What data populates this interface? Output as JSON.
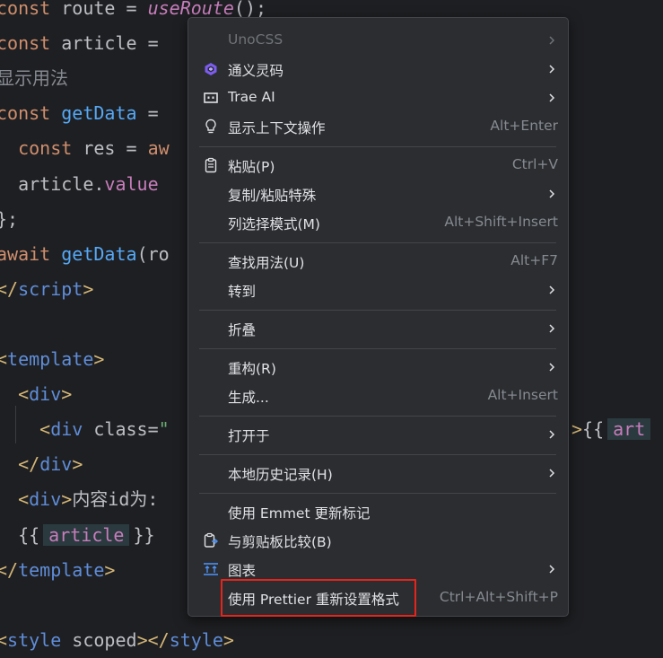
{
  "editor": {
    "lines": [
      {
        "parts": [
          [
            "kw",
            "const"
          ],
          [
            "txt",
            " route = "
          ],
          [
            "it",
            "useRoute"
          ],
          [
            "txt",
            "();"
          ]
        ]
      },
      {
        "parts": [
          [
            "kw",
            "const"
          ],
          [
            "txt",
            " article = "
          ]
        ]
      },
      {
        "parts": [
          [
            "cmt",
            "显示用法"
          ]
        ]
      },
      {
        "parts": [
          [
            "kw",
            "const"
          ],
          [
            "txt",
            " "
          ],
          [
            "fn",
            "getData"
          ],
          [
            "txt",
            " ="
          ]
        ]
      },
      {
        "parts": [
          [
            "txt",
            "  "
          ],
          [
            "kw",
            "const"
          ],
          [
            "txt",
            " res = "
          ],
          [
            "kw",
            "aw"
          ]
        ]
      },
      {
        "parts": [
          [
            "txt",
            "  article."
          ],
          [
            "prop",
            "value"
          ]
        ]
      },
      {
        "parts": [
          [
            "txt",
            "};"
          ]
        ]
      },
      {
        "parts": [
          [
            "kw",
            "await"
          ],
          [
            "txt",
            " "
          ],
          [
            "fn",
            "getData"
          ],
          [
            "txt",
            "(ro"
          ]
        ]
      },
      {
        "parts": [
          [
            "tag",
            "</"
          ],
          [
            "tg",
            "script"
          ],
          [
            "tag",
            ">"
          ]
        ]
      },
      {
        "parts": []
      },
      {
        "parts": [
          [
            "tag",
            "<"
          ],
          [
            "tg",
            "template"
          ],
          [
            "tag",
            ">"
          ]
        ]
      },
      {
        "parts": [
          [
            "txt",
            "  "
          ],
          [
            "tag",
            "<"
          ],
          [
            "tg",
            "div"
          ],
          [
            "tag",
            ">"
          ]
        ]
      },
      {
        "parts": [
          [
            "txt",
            "    "
          ],
          [
            "tag",
            "<"
          ],
          [
            "tg",
            "div"
          ],
          [
            "txt",
            " class="
          ],
          [
            "str",
            "\""
          ]
        ]
      },
      {
        "parts": [
          [
            "txt",
            "  "
          ],
          [
            "tag",
            "</"
          ],
          [
            "tg",
            "div"
          ],
          [
            "tag",
            ">"
          ]
        ]
      },
      {
        "parts": [
          [
            "txt",
            "  "
          ],
          [
            "tag",
            "<"
          ],
          [
            "tg",
            "div"
          ],
          [
            "tag",
            ">"
          ],
          [
            "txt",
            "内容id为:"
          ]
        ]
      },
      {
        "parts": [
          [
            "txt",
            "  {{"
          ],
          [
            "hl",
            "article"
          ],
          [
            "txt",
            "}}"
          ]
        ]
      },
      {
        "parts": [
          [
            "tag",
            "</"
          ],
          [
            "tg",
            "template"
          ],
          [
            "tag",
            ">"
          ]
        ]
      },
      {
        "parts": []
      },
      {
        "parts": [
          [
            "tag",
            "<"
          ],
          [
            "tg",
            "style"
          ],
          [
            "txt",
            " scoped"
          ],
          [
            "tag",
            "></"
          ],
          [
            "tg",
            "style"
          ],
          [
            "tag",
            ">"
          ]
        ]
      }
    ],
    "overflow_right": [
      {
        "line": 12,
        "parts": [
          [
            "tag",
            ">"
          ],
          [
            "txt",
            "{{"
          ],
          [
            "hl",
            "art"
          ]
        ]
      }
    ]
  },
  "menu": {
    "groups": [
      [
        {
          "label": "UnoCSS",
          "shortcut": "",
          "submenu": true,
          "disabled": true,
          "icon": "none"
        },
        {
          "label": "通义灵码",
          "shortcut": "",
          "submenu": true,
          "icon": "tongyi-icon"
        },
        {
          "label": "Trae AI",
          "shortcut": "",
          "submenu": true,
          "icon": "trae-icon"
        },
        {
          "label": "显示上下文操作",
          "shortcut": "Alt+Enter",
          "submenu": false,
          "icon": "lightbulb-icon"
        }
      ],
      [
        {
          "label": "粘贴(P)",
          "shortcut": "Ctrl+V",
          "submenu": false,
          "icon": "clipboard-icon"
        },
        {
          "label": "复制/粘贴特殊",
          "shortcut": "",
          "submenu": true,
          "icon": "none"
        },
        {
          "label": "列选择模式(M)",
          "shortcut": "Alt+Shift+Insert",
          "submenu": false,
          "icon": "none"
        }
      ],
      [
        {
          "label": "查找用法(U)",
          "shortcut": "Alt+F7",
          "submenu": false,
          "icon": "none"
        },
        {
          "label": "转到",
          "shortcut": "",
          "submenu": true,
          "icon": "none"
        }
      ],
      [
        {
          "label": "折叠",
          "shortcut": "",
          "submenu": true,
          "icon": "none"
        }
      ],
      [
        {
          "label": "重构(R)",
          "shortcut": "",
          "submenu": true,
          "icon": "none"
        },
        {
          "label": "生成...",
          "shortcut": "Alt+Insert",
          "submenu": false,
          "icon": "none"
        }
      ],
      [
        {
          "label": "打开于",
          "shortcut": "",
          "submenu": true,
          "icon": "none"
        }
      ],
      [
        {
          "label": "本地历史记录(H)",
          "shortcut": "",
          "submenu": true,
          "icon": "none"
        }
      ],
      [
        {
          "label": "使用 Emmet 更新标记",
          "shortcut": "",
          "submenu": false,
          "icon": "none"
        },
        {
          "label": "与剪贴板比较(B)",
          "shortcut": "",
          "submenu": false,
          "icon": "compare-clipboard-icon"
        },
        {
          "label": "图表",
          "shortcut": "",
          "submenu": true,
          "icon": "diagram-icon"
        },
        {
          "label": "使用 Prettier 重新设置格式",
          "shortcut": "Ctrl+Alt+Shift+P",
          "submenu": false,
          "icon": "none",
          "highlighted": true
        }
      ]
    ]
  },
  "colors": {
    "editor_bg": "#1e1f22",
    "menu_bg": "#2b2d30",
    "highlight_border": "#e5251c"
  }
}
